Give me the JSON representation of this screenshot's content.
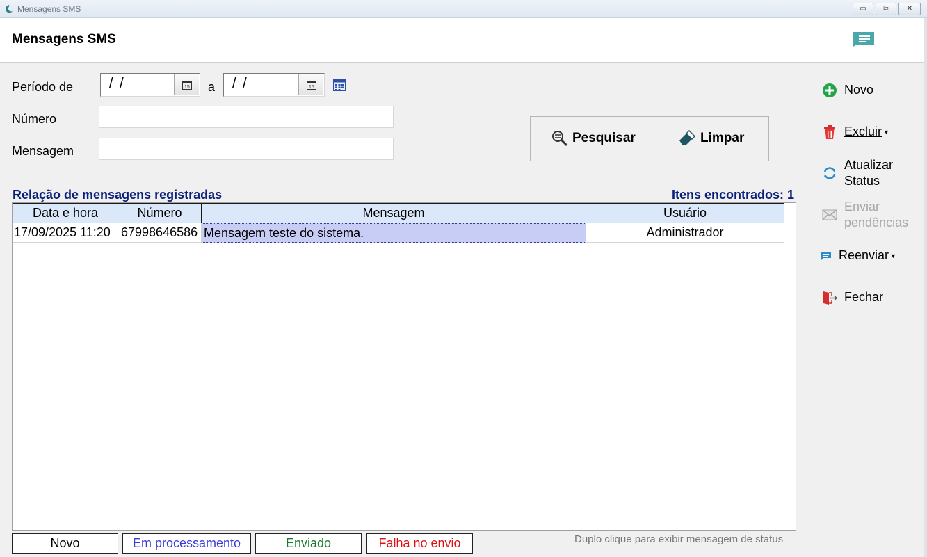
{
  "window": {
    "title": "Mensagens SMS",
    "controls": {
      "minimize": "▭",
      "maximize": "⧉",
      "close": "✕"
    }
  },
  "header": {
    "title": "Mensagens SMS"
  },
  "filters": {
    "period_label": "Período de",
    "period_from": "/ /",
    "period_separator": "a",
    "period_to": "/ /",
    "number_label": "Número",
    "number_value": "",
    "message_label": "Mensagem",
    "message_value": ""
  },
  "actions": {
    "search_label": "Pesquisar",
    "clear_label": "Limpar"
  },
  "list": {
    "title": "Relação de mensagens registradas",
    "count_text": "Itens encontrados: 1",
    "columns": [
      "Data e hora",
      "Número",
      "Mensagem",
      "Usuário"
    ],
    "rows": [
      {
        "datetime": "17/09/2025 11:20",
        "number": "67998646586",
        "message": "Mensagem teste do sistema.",
        "user": "Administrador"
      }
    ]
  },
  "legend": {
    "items": [
      {
        "label": "Novo",
        "color": "#000000"
      },
      {
        "label": "Em processamento",
        "color": "#3b3bd8"
      },
      {
        "label": "Enviado",
        "color": "#1f7a2e"
      },
      {
        "label": "Falha no envio",
        "color": "#e01010"
      }
    ],
    "hint": "Duplo clique para exibir mensagem de status"
  },
  "sidebar": {
    "new": "Novo",
    "delete": "Excluir",
    "update_status_line1": "Atualizar",
    "update_status_line2": "Status",
    "send_pending_line1": "Enviar",
    "send_pending_line2": "pendências",
    "resend": "Reenviar",
    "close": "Fechar"
  },
  "colors": {
    "accent_title": "#0a1f7a",
    "grid_header_bg": "#dbe8fa",
    "selected_cell_bg": "#c8cdf5",
    "sms_icon": "#4aa8a8"
  }
}
